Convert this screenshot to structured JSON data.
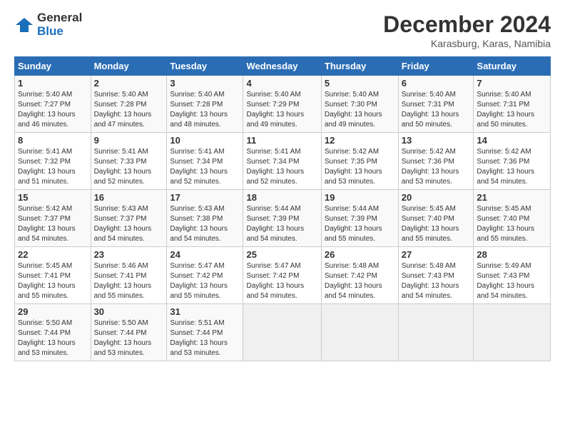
{
  "logo": {
    "general": "General",
    "blue": "Blue"
  },
  "title": "December 2024",
  "subtitle": "Karasburg, Karas, Namibia",
  "days_header": [
    "Sunday",
    "Monday",
    "Tuesday",
    "Wednesday",
    "Thursday",
    "Friday",
    "Saturday"
  ],
  "weeks": [
    [
      {
        "day": "1",
        "sunrise": "5:40 AM",
        "sunset": "7:27 PM",
        "daylight": "13 hours and 46 minutes."
      },
      {
        "day": "2",
        "sunrise": "5:40 AM",
        "sunset": "7:28 PM",
        "daylight": "13 hours and 47 minutes."
      },
      {
        "day": "3",
        "sunrise": "5:40 AM",
        "sunset": "7:28 PM",
        "daylight": "13 hours and 48 minutes."
      },
      {
        "day": "4",
        "sunrise": "5:40 AM",
        "sunset": "7:29 PM",
        "daylight": "13 hours and 49 minutes."
      },
      {
        "day": "5",
        "sunrise": "5:40 AM",
        "sunset": "7:30 PM",
        "daylight": "13 hours and 49 minutes."
      },
      {
        "day": "6",
        "sunrise": "5:40 AM",
        "sunset": "7:31 PM",
        "daylight": "13 hours and 50 minutes."
      },
      {
        "day": "7",
        "sunrise": "5:40 AM",
        "sunset": "7:31 PM",
        "daylight": "13 hours and 50 minutes."
      }
    ],
    [
      {
        "day": "8",
        "sunrise": "5:41 AM",
        "sunset": "7:32 PM",
        "daylight": "13 hours and 51 minutes."
      },
      {
        "day": "9",
        "sunrise": "5:41 AM",
        "sunset": "7:33 PM",
        "daylight": "13 hours and 52 minutes."
      },
      {
        "day": "10",
        "sunrise": "5:41 AM",
        "sunset": "7:34 PM",
        "daylight": "13 hours and 52 minutes."
      },
      {
        "day": "11",
        "sunrise": "5:41 AM",
        "sunset": "7:34 PM",
        "daylight": "13 hours and 52 minutes."
      },
      {
        "day": "12",
        "sunrise": "5:42 AM",
        "sunset": "7:35 PM",
        "daylight": "13 hours and 53 minutes."
      },
      {
        "day": "13",
        "sunrise": "5:42 AM",
        "sunset": "7:36 PM",
        "daylight": "13 hours and 53 minutes."
      },
      {
        "day": "14",
        "sunrise": "5:42 AM",
        "sunset": "7:36 PM",
        "daylight": "13 hours and 54 minutes."
      }
    ],
    [
      {
        "day": "15",
        "sunrise": "5:42 AM",
        "sunset": "7:37 PM",
        "daylight": "13 hours and 54 minutes."
      },
      {
        "day": "16",
        "sunrise": "5:43 AM",
        "sunset": "7:37 PM",
        "daylight": "13 hours and 54 minutes."
      },
      {
        "day": "17",
        "sunrise": "5:43 AM",
        "sunset": "7:38 PM",
        "daylight": "13 hours and 54 minutes."
      },
      {
        "day": "18",
        "sunrise": "5:44 AM",
        "sunset": "7:39 PM",
        "daylight": "13 hours and 54 minutes."
      },
      {
        "day": "19",
        "sunrise": "5:44 AM",
        "sunset": "7:39 PM",
        "daylight": "13 hours and 55 minutes."
      },
      {
        "day": "20",
        "sunrise": "5:45 AM",
        "sunset": "7:40 PM",
        "daylight": "13 hours and 55 minutes."
      },
      {
        "day": "21",
        "sunrise": "5:45 AM",
        "sunset": "7:40 PM",
        "daylight": "13 hours and 55 minutes."
      }
    ],
    [
      {
        "day": "22",
        "sunrise": "5:45 AM",
        "sunset": "7:41 PM",
        "daylight": "13 hours and 55 minutes."
      },
      {
        "day": "23",
        "sunrise": "5:46 AM",
        "sunset": "7:41 PM",
        "daylight": "13 hours and 55 minutes."
      },
      {
        "day": "24",
        "sunrise": "5:47 AM",
        "sunset": "7:42 PM",
        "daylight": "13 hours and 55 minutes."
      },
      {
        "day": "25",
        "sunrise": "5:47 AM",
        "sunset": "7:42 PM",
        "daylight": "13 hours and 54 minutes."
      },
      {
        "day": "26",
        "sunrise": "5:48 AM",
        "sunset": "7:42 PM",
        "daylight": "13 hours and 54 minutes."
      },
      {
        "day": "27",
        "sunrise": "5:48 AM",
        "sunset": "7:43 PM",
        "daylight": "13 hours and 54 minutes."
      },
      {
        "day": "28",
        "sunrise": "5:49 AM",
        "sunset": "7:43 PM",
        "daylight": "13 hours and 54 minutes."
      }
    ],
    [
      {
        "day": "29",
        "sunrise": "5:50 AM",
        "sunset": "7:44 PM",
        "daylight": "13 hours and 53 minutes."
      },
      {
        "day": "30",
        "sunrise": "5:50 AM",
        "sunset": "7:44 PM",
        "daylight": "13 hours and 53 minutes."
      },
      {
        "day": "31",
        "sunrise": "5:51 AM",
        "sunset": "7:44 PM",
        "daylight": "13 hours and 53 minutes."
      },
      null,
      null,
      null,
      null
    ]
  ],
  "labels": {
    "sunrise": "Sunrise:",
    "sunset": "Sunset:",
    "daylight": "Daylight:"
  }
}
